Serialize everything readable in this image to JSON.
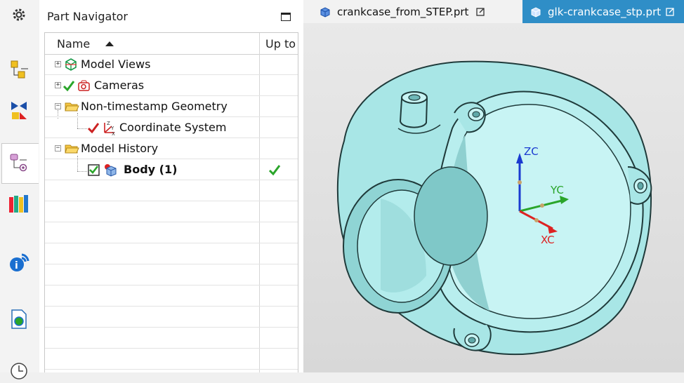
{
  "navigator": {
    "title": "Part Navigator",
    "columns": {
      "name": "Name",
      "upto": "Up to"
    },
    "rows": [
      {
        "label": "Model Views",
        "bold": false
      },
      {
        "label": "Cameras",
        "bold": false
      },
      {
        "label": "Non-timestamp Geometry",
        "bold": false
      },
      {
        "label": "Coordinate System",
        "bold": false
      },
      {
        "label": "Model History",
        "bold": false
      },
      {
        "label": "Body (1)",
        "bold": true,
        "upto_check": true
      }
    ]
  },
  "tabs": [
    {
      "label": "crankcase_from_STEP.prt",
      "active": false
    },
    {
      "label": "glk-crankcase_stp.prt",
      "active": true
    }
  ],
  "viewport": {
    "axes": {
      "x": "XC",
      "y": "YC",
      "z": "ZC"
    },
    "model_color": "#a8e6e6"
  },
  "colors": {
    "accent": "#2f8ec7",
    "check": "#2aa52a"
  },
  "sidebar_icons": [
    "settings-gear-icon",
    "assembly-navigator-icon",
    "constraint-navigator-icon",
    "part-navigator-icon",
    "reuse-library-icon",
    "hd3d-tools-icon",
    "web-browser-icon",
    "history-icon"
  ]
}
